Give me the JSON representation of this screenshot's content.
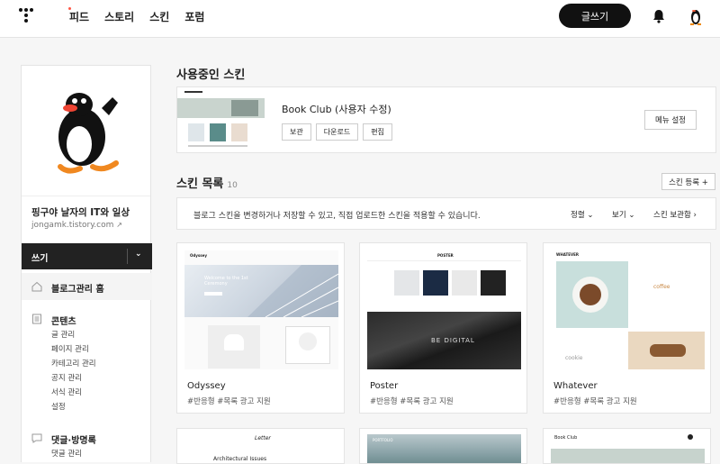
{
  "nav": {
    "items": [
      "피드",
      "스토리",
      "스킨",
      "포럼"
    ]
  },
  "header": {
    "write_label": "글쓰기"
  },
  "sidebar": {
    "blog_title": "핑구야 날자의 IT와 일상",
    "blog_url": "jongamk.tistory.com",
    "write_label": "쓰기",
    "home_label": "블로그관리 홈",
    "content": {
      "label": "콘텐츠",
      "items": [
        "글 관리",
        "페이지 관리",
        "카테고리 관리",
        "공지 관리",
        "서식 관리",
        "설정"
      ]
    },
    "comments": {
      "label": "댓글·방명록",
      "items": [
        "댓글 관리"
      ]
    }
  },
  "active_skin": {
    "heading": "사용중인 스킨",
    "name": "Book Club (사용자 수정)",
    "buttons": [
      "보관",
      "다운로드",
      "편집"
    ],
    "menu_settings": "메뉴 설정"
  },
  "skin_list": {
    "heading": "스킨 목록",
    "count": "10",
    "register_label": "스킨 등록 +",
    "info": "블로그 스킨을 변경하거나 저장할 수 있고, 직접 업로드한 스킨을 적용할 수 있습니다.",
    "sort_label": "정렬",
    "view_label": "보기",
    "archive_label": "스킨 보관함",
    "cards": [
      {
        "name": "Odyssey",
        "tags": "#반응형   #목록 광고 지원"
      },
      {
        "name": "Poster",
        "tags": "#반응형   #목록 광고 지원"
      },
      {
        "name": "Whatever",
        "tags": "#반응형   #목록 광고 지원"
      }
    ],
    "thumb_text": {
      "odyssey_title": "Welcome to the 1st Ceremony",
      "odyssey_logo": "Odyssey",
      "poster_logo": "POSTER",
      "poster_banner": "BE DIGITAL",
      "whatever_logo": "WHATEVER",
      "whatever_coffee": "coffee",
      "whatever_cookie": "cookie",
      "letter_logo": "Letter",
      "letter_heading": "Architectural Issues",
      "portfolio_label": "PORTFOLIO",
      "bookclub_logo": "Book Club"
    }
  },
  "colors": {
    "accent": "#ff5544",
    "dark": "#111111"
  }
}
